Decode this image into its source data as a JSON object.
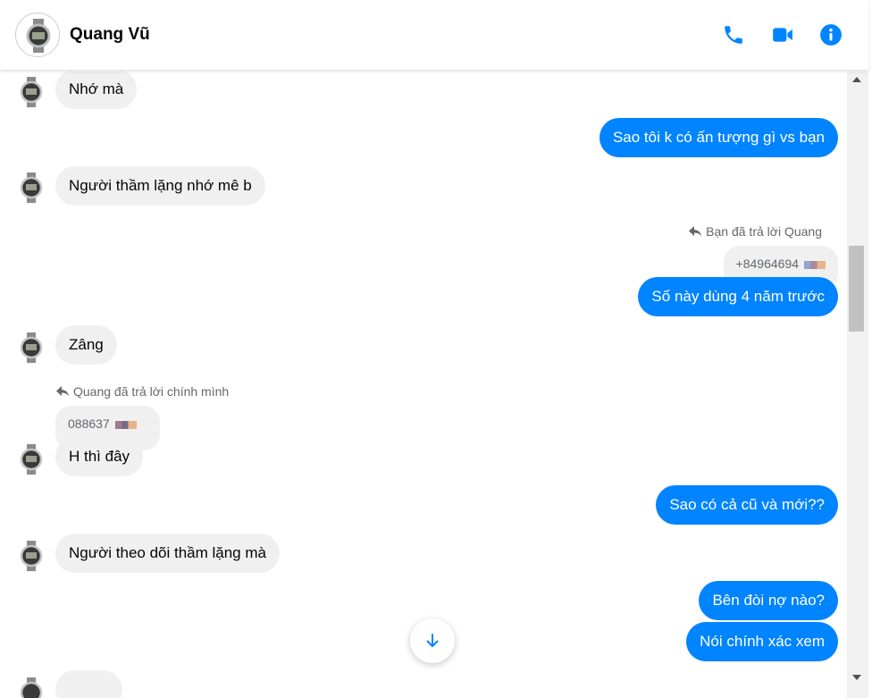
{
  "contact": {
    "name": "Quang Vũ",
    "avatar": "watch-avatar"
  },
  "header_actions": [
    {
      "name": "phone-icon",
      "color": "#0084ff"
    },
    {
      "name": "video-icon",
      "color": "#0084ff"
    },
    {
      "name": "info-icon",
      "color": "#0084ff"
    }
  ],
  "messages": {
    "m1": "Nhớ mà",
    "m2": "Sao tôi k có ấn tượng gì vs bạn",
    "m3": "Người thầm lặng nhớ mê b",
    "reply1_label": "Bạn đã trả lời Quang",
    "reply1_quote": "+84964694",
    "m4": "Số này dùng 4 năm trước",
    "m5": "Zâng",
    "reply2_label": "Quang đã trả lời chính mình",
    "reply2_quote": "088637",
    "m6": "H thì đây",
    "m7": "Sao có cả cũ và mới??",
    "m8": "Người theo dõi thầm lặng mà",
    "m9": "Bên đòi nợ nào?",
    "m10": "Nói chính xác xem"
  },
  "colors": {
    "outgoing_bubble": "#0084ff",
    "incoming_bubble": "#f0f0f0",
    "accent": "#0084ff"
  }
}
